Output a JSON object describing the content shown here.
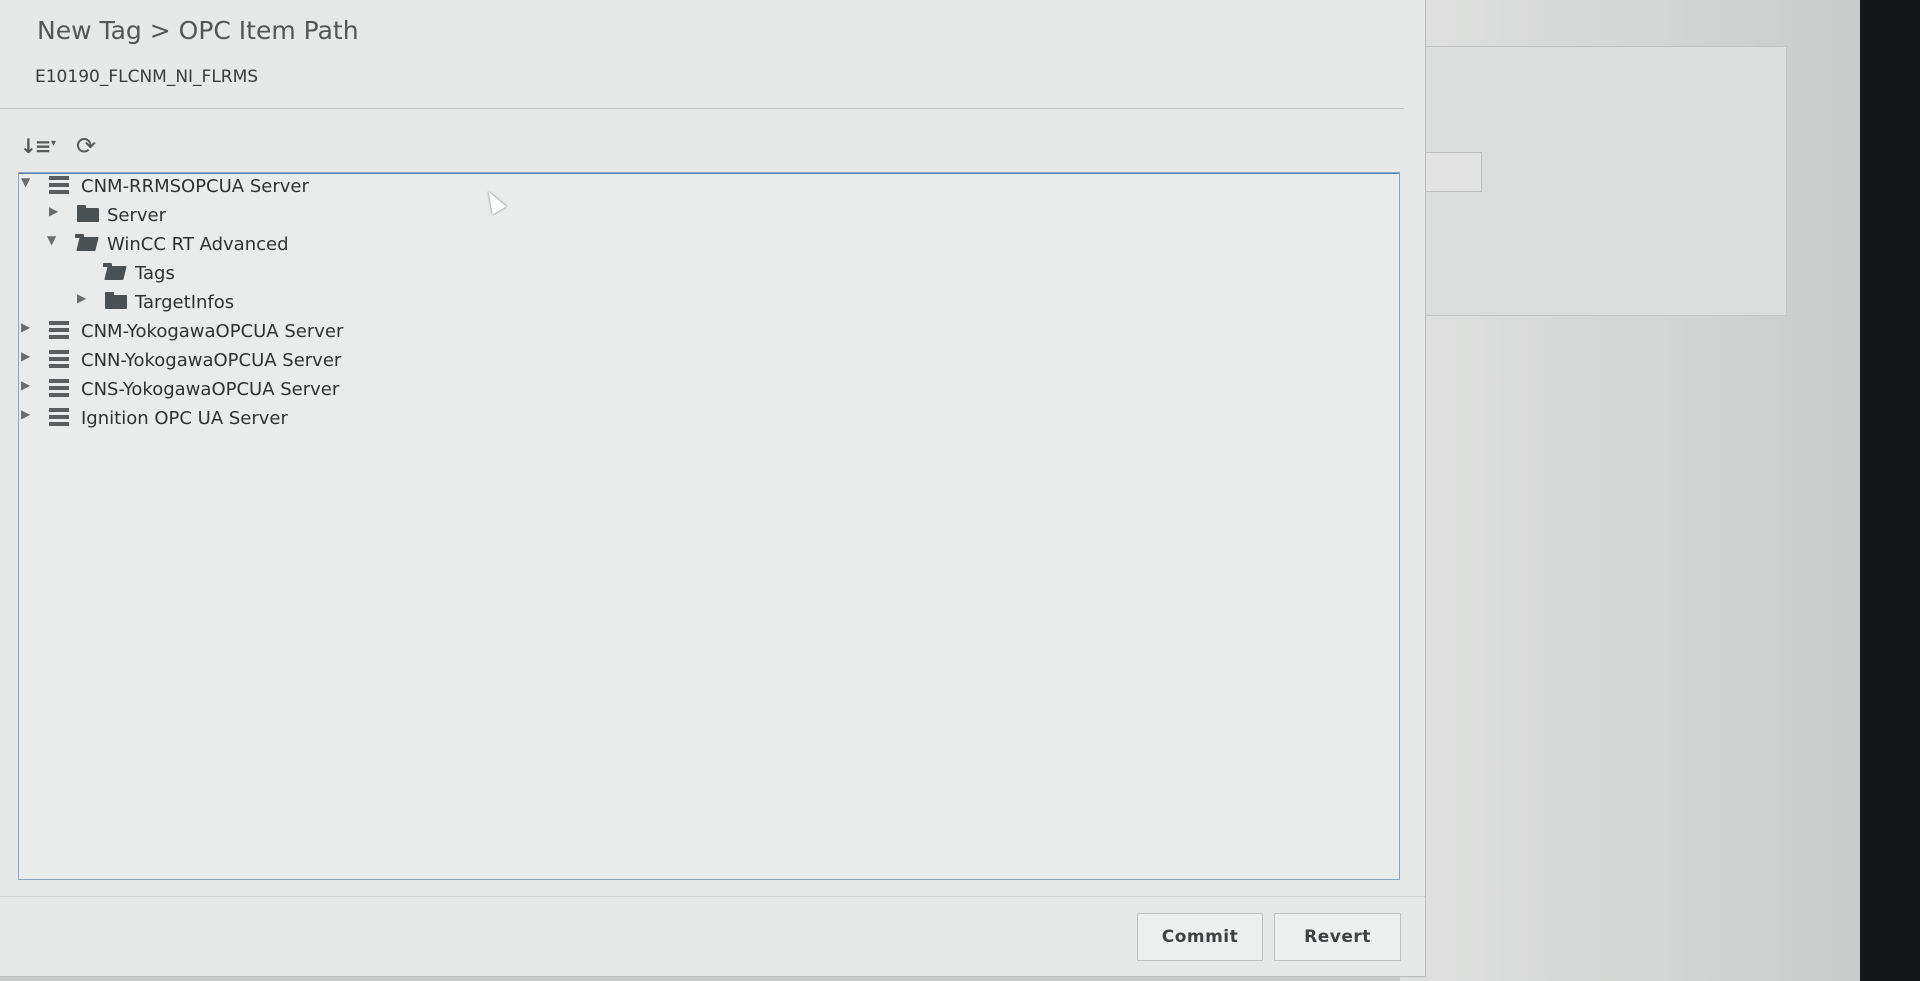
{
  "dialog": {
    "title": "New Tag > OPC Item Path",
    "subtitle": "E10190_FLCNM_NI_FLRMS"
  },
  "toolbar": {
    "sort_icon": "sort-icon",
    "refresh_icon": "refresh-icon"
  },
  "tree": {
    "nodes": [
      {
        "label": "CNM-RRMSOPCUA Server",
        "icon": "server-icon",
        "expanded": true
      },
      {
        "label": "Server",
        "icon": "folder-icon",
        "expanded": false
      },
      {
        "label": "WinCC RT Advanced",
        "icon": "folder-open-icon",
        "expanded": true
      },
      {
        "label": "Tags",
        "icon": "folder-open-icon"
      },
      {
        "label": "TargetInfos",
        "icon": "folder-icon",
        "expanded": false
      },
      {
        "label": "CNM-YokogawaOPCUA Server",
        "icon": "server-icon",
        "expanded": false
      },
      {
        "label": "CNN-YokogawaOPCUA Server",
        "icon": "server-icon",
        "expanded": false
      },
      {
        "label": "CNS-YokogawaOPCUA Server",
        "icon": "server-icon",
        "expanded": false
      },
      {
        "label": "Ignition OPC UA Server",
        "icon": "server-icon",
        "expanded": false
      }
    ]
  },
  "footer": {
    "commit_label": "Commit",
    "revert_label": "Revert"
  },
  "colors": {
    "dialog_bg": "#e7e9e8",
    "tree_border": "#8ba3bd",
    "text": "#2f3232"
  }
}
